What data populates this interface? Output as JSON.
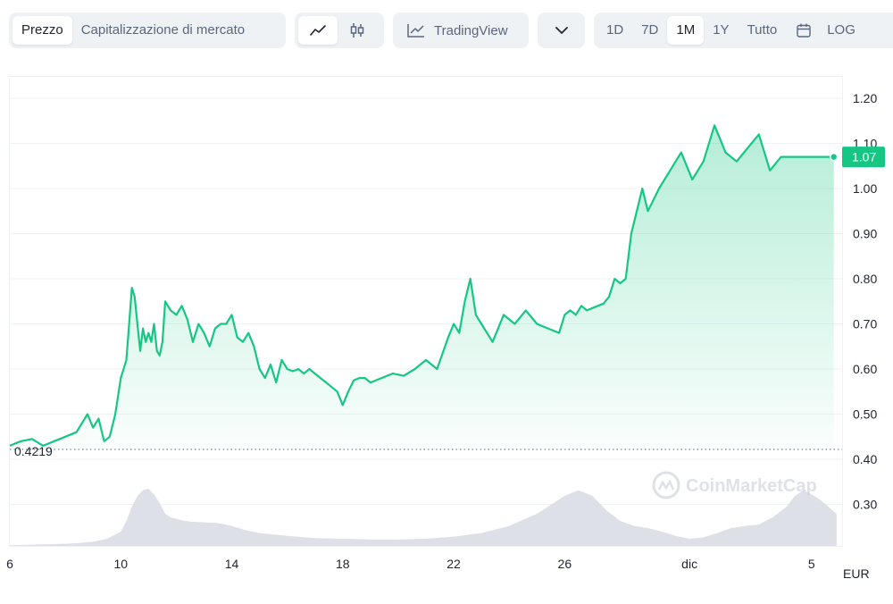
{
  "toolbar": {
    "metric_tabs": [
      {
        "label": "Prezzo",
        "active": true
      },
      {
        "label": "Capitalizzazione di mercato",
        "active": false
      }
    ],
    "chart_type_icons": [
      "line-chart-icon",
      "candlestick-icon"
    ],
    "tradingview_label": "TradingView",
    "tradingview_icon": "trend-line-icon",
    "dropdown_icon": "chevron-down-icon",
    "range_tabs": [
      {
        "label": "1D",
        "active": false
      },
      {
        "label": "7D",
        "active": false
      },
      {
        "label": "1M",
        "active": true
      },
      {
        "label": "1Y",
        "active": false
      },
      {
        "label": "Tutto",
        "active": false
      }
    ],
    "calendar_icon": "calendar-icon",
    "log_label": "LOG"
  },
  "chart_data": {
    "type": "area",
    "currency_label": "EUR",
    "watermark": "CoinMarketCap",
    "price_line_color": "#16c784",
    "open_price_label": "0.4219",
    "open_price": 0.4219,
    "current_price_label": "1.07",
    "current_price": 1.07,
    "y_ticks": [
      "1.20",
      "1.10",
      "1.00",
      "0.90",
      "0.80",
      "0.70",
      "0.60",
      "0.50",
      "0.40",
      "0.30"
    ],
    "ylim": [
      0.2,
      1.2
    ],
    "x_ticks": [
      {
        "label": "6",
        "t": 0
      },
      {
        "label": "10",
        "t": 4
      },
      {
        "label": "14",
        "t": 8
      },
      {
        "label": "18",
        "t": 12
      },
      {
        "label": "22",
        "t": 16
      },
      {
        "label": "26",
        "t": 20
      },
      {
        "label": "dic",
        "t": 24.5
      },
      {
        "label": "5",
        "t": 28.9
      }
    ],
    "price_series": {
      "x": [
        0.0,
        0.4,
        0.8,
        1.2,
        1.6,
        2.0,
        2.4,
        2.8,
        3.0,
        3.2,
        3.4,
        3.6,
        3.8,
        4.0,
        4.2,
        4.4,
        4.5,
        4.6,
        4.7,
        4.8,
        4.9,
        5.0,
        5.1,
        5.2,
        5.3,
        5.4,
        5.5,
        5.6,
        5.8,
        6.0,
        6.2,
        6.4,
        6.6,
        6.8,
        7.0,
        7.2,
        7.4,
        7.6,
        7.8,
        8.0,
        8.2,
        8.4,
        8.6,
        8.8,
        9.0,
        9.2,
        9.4,
        9.6,
        9.8,
        10.0,
        10.2,
        10.4,
        10.6,
        10.8,
        11.0,
        11.2,
        11.4,
        11.6,
        11.8,
        12.0,
        12.2,
        12.4,
        12.6,
        12.8,
        13.0,
        13.4,
        13.8,
        14.2,
        14.6,
        15.0,
        15.4,
        15.8,
        16.0,
        16.2,
        16.4,
        16.6,
        16.8,
        17.0,
        17.4,
        17.8,
        18.2,
        18.6,
        19.0,
        19.4,
        19.8,
        20.0,
        20.2,
        20.4,
        20.6,
        20.8,
        21.0,
        21.2,
        21.4,
        21.6,
        21.8,
        22.0,
        22.2,
        22.4,
        22.6,
        22.8,
        23.0,
        23.4,
        23.8,
        24.2,
        24.6,
        25.0,
        25.4,
        25.8,
        26.2,
        26.6,
        27.0,
        27.4,
        27.8,
        28.0,
        28.2,
        28.4,
        28.6,
        28.7,
        28.8,
        28.9,
        29.0,
        29.1,
        29.2,
        29.3,
        29.4,
        29.5,
        29.6,
        29.7
      ],
      "y": [
        0.43,
        0.44,
        0.445,
        0.43,
        0.44,
        0.45,
        0.46,
        0.5,
        0.47,
        0.49,
        0.44,
        0.45,
        0.5,
        0.58,
        0.62,
        0.78,
        0.76,
        0.7,
        0.64,
        0.69,
        0.66,
        0.68,
        0.66,
        0.7,
        0.64,
        0.63,
        0.66,
        0.75,
        0.73,
        0.72,
        0.74,
        0.71,
        0.66,
        0.7,
        0.68,
        0.65,
        0.69,
        0.7,
        0.7,
        0.72,
        0.67,
        0.66,
        0.68,
        0.65,
        0.6,
        0.58,
        0.61,
        0.57,
        0.62,
        0.6,
        0.595,
        0.6,
        0.59,
        0.6,
        0.59,
        0.58,
        0.57,
        0.56,
        0.55,
        0.52,
        0.55,
        0.575,
        0.58,
        0.58,
        0.57,
        0.58,
        0.59,
        0.585,
        0.6,
        0.62,
        0.6,
        0.67,
        0.7,
        0.68,
        0.75,
        0.8,
        0.72,
        0.7,
        0.66,
        0.72,
        0.7,
        0.73,
        0.7,
        0.69,
        0.68,
        0.72,
        0.73,
        0.72,
        0.74,
        0.73,
        0.735,
        0.74,
        0.745,
        0.76,
        0.8,
        0.79,
        0.8,
        0.9,
        0.95,
        1.0,
        0.95,
        1.0,
        1.04,
        1.08,
        1.02,
        1.06,
        1.14,
        1.08,
        1.06,
        1.09,
        1.12,
        1.04,
        1.07,
        1.07,
        1.07,
        1.07,
        1.07,
        1.07,
        1.07,
        1.07,
        1.07,
        1.07,
        1.07,
        1.07,
        1.07,
        1.07,
        1.07,
        1.07
      ]
    },
    "volume_series": {
      "x": [
        0,
        1,
        2,
        2.5,
        3,
        3.5,
        4,
        4.2,
        4.4,
        4.6,
        4.8,
        5.0,
        5.2,
        5.4,
        5.6,
        5.8,
        6.0,
        6.2,
        6.5,
        7,
        7.5,
        8,
        8.5,
        9,
        10,
        11,
        12,
        13,
        14,
        15,
        16,
        17,
        18,
        19,
        20,
        20.5,
        21,
        21.5,
        22,
        22.5,
        23,
        23.5,
        24,
        24.5,
        25,
        25.5,
        26,
        26.5,
        27,
        27.5,
        28,
        28.3,
        28.6,
        28.9,
        29.2,
        29.5,
        29.8
      ],
      "values": [
        0.01,
        0.02,
        0.03,
        0.04,
        0.06,
        0.1,
        0.2,
        0.35,
        0.55,
        0.7,
        0.78,
        0.8,
        0.72,
        0.6,
        0.45,
        0.4,
        0.38,
        0.36,
        0.34,
        0.33,
        0.32,
        0.28,
        0.22,
        0.18,
        0.14,
        0.11,
        0.1,
        0.09,
        0.09,
        0.1,
        0.13,
        0.18,
        0.28,
        0.45,
        0.7,
        0.78,
        0.7,
        0.5,
        0.35,
        0.28,
        0.25,
        0.2,
        0.14,
        0.1,
        0.12,
        0.18,
        0.25,
        0.28,
        0.3,
        0.4,
        0.55,
        0.7,
        0.78,
        0.72,
        0.65,
        0.55,
        0.45
      ]
    }
  }
}
